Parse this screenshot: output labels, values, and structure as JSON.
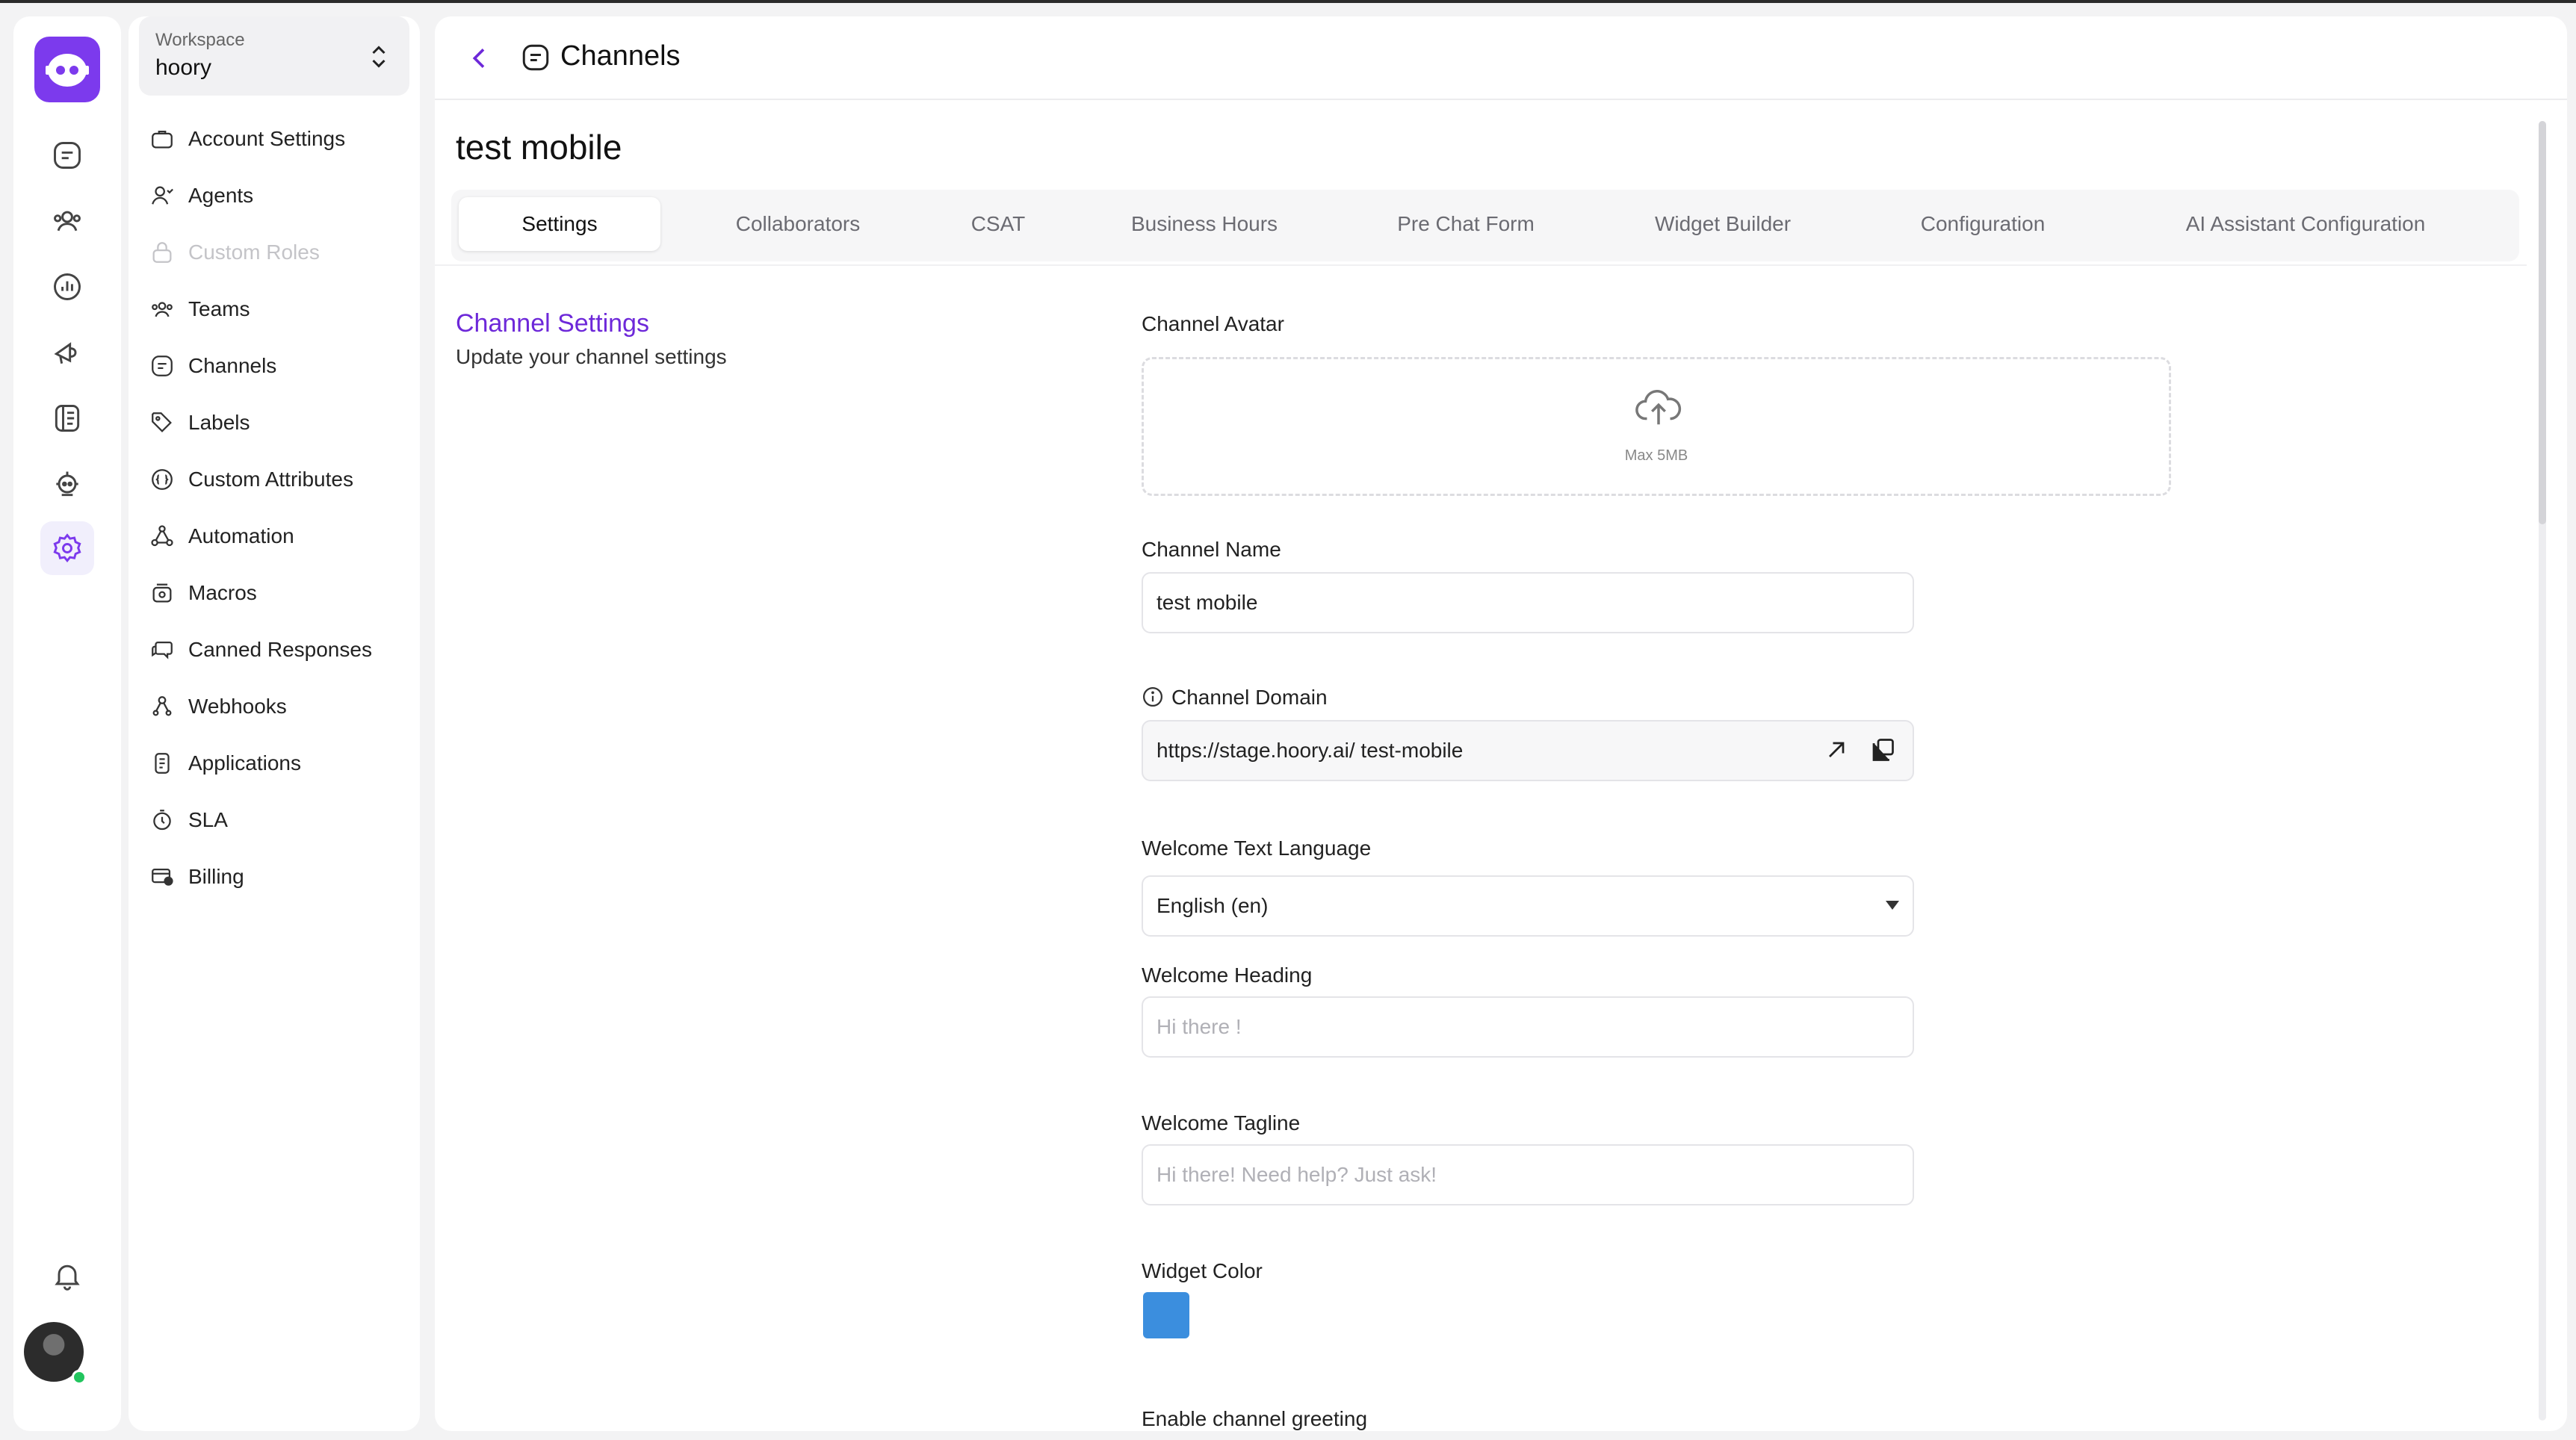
{
  "colors": {
    "accent": "#7c3aed",
    "link": "#6d28d9",
    "widget_color": "#3b8ede"
  },
  "workspace": {
    "label": "Workspace",
    "name": "hoory"
  },
  "sidebar": {
    "items": [
      {
        "label": "Account Settings",
        "icon": "briefcase-icon"
      },
      {
        "label": "Agents",
        "icon": "user-icon"
      },
      {
        "label": "Custom Roles",
        "icon": "lock-icon",
        "disabled": true
      },
      {
        "label": "Teams",
        "icon": "team-icon"
      },
      {
        "label": "Channels",
        "icon": "channel-icon"
      },
      {
        "label": "Labels",
        "icon": "tag-icon"
      },
      {
        "label": "Custom Attributes",
        "icon": "attributes-icon"
      },
      {
        "label": "Automation",
        "icon": "automation-icon"
      },
      {
        "label": "Macros",
        "icon": "macros-icon"
      },
      {
        "label": "Canned Responses",
        "icon": "chat-bubbles-icon"
      },
      {
        "label": "Webhooks",
        "icon": "webhook-icon"
      },
      {
        "label": "Applications",
        "icon": "apps-icon"
      },
      {
        "label": "SLA",
        "icon": "timer-icon"
      },
      {
        "label": "Billing",
        "icon": "billing-icon"
      }
    ]
  },
  "header": {
    "title": "Channels"
  },
  "page": {
    "title": "test mobile"
  },
  "tabs": [
    {
      "label": "Settings",
      "active": true
    },
    {
      "label": "Collaborators"
    },
    {
      "label": "CSAT"
    },
    {
      "label": "Business Hours"
    },
    {
      "label": "Pre Chat Form"
    },
    {
      "label": "Widget Builder"
    },
    {
      "label": "Configuration"
    },
    {
      "label": "AI Assistant Configuration"
    }
  ],
  "section": {
    "title": "Channel Settings",
    "description": "Update your channel settings"
  },
  "form": {
    "avatar_label": "Channel Avatar",
    "avatar_max": "Max 5MB",
    "name_label": "Channel Name",
    "name_value": "test mobile",
    "domain_label": "Channel Domain",
    "domain_value": "https://stage.hoory.ai/ test-mobile",
    "language_label": "Welcome Text Language",
    "language_value": "English (en)",
    "heading_label": "Welcome Heading",
    "heading_placeholder": "Hi there !",
    "tagline_label": "Welcome Tagline",
    "tagline_placeholder": "Hi there! Need help? Just ask!",
    "color_label": "Widget Color",
    "greeting_label": "Enable channel greeting"
  }
}
